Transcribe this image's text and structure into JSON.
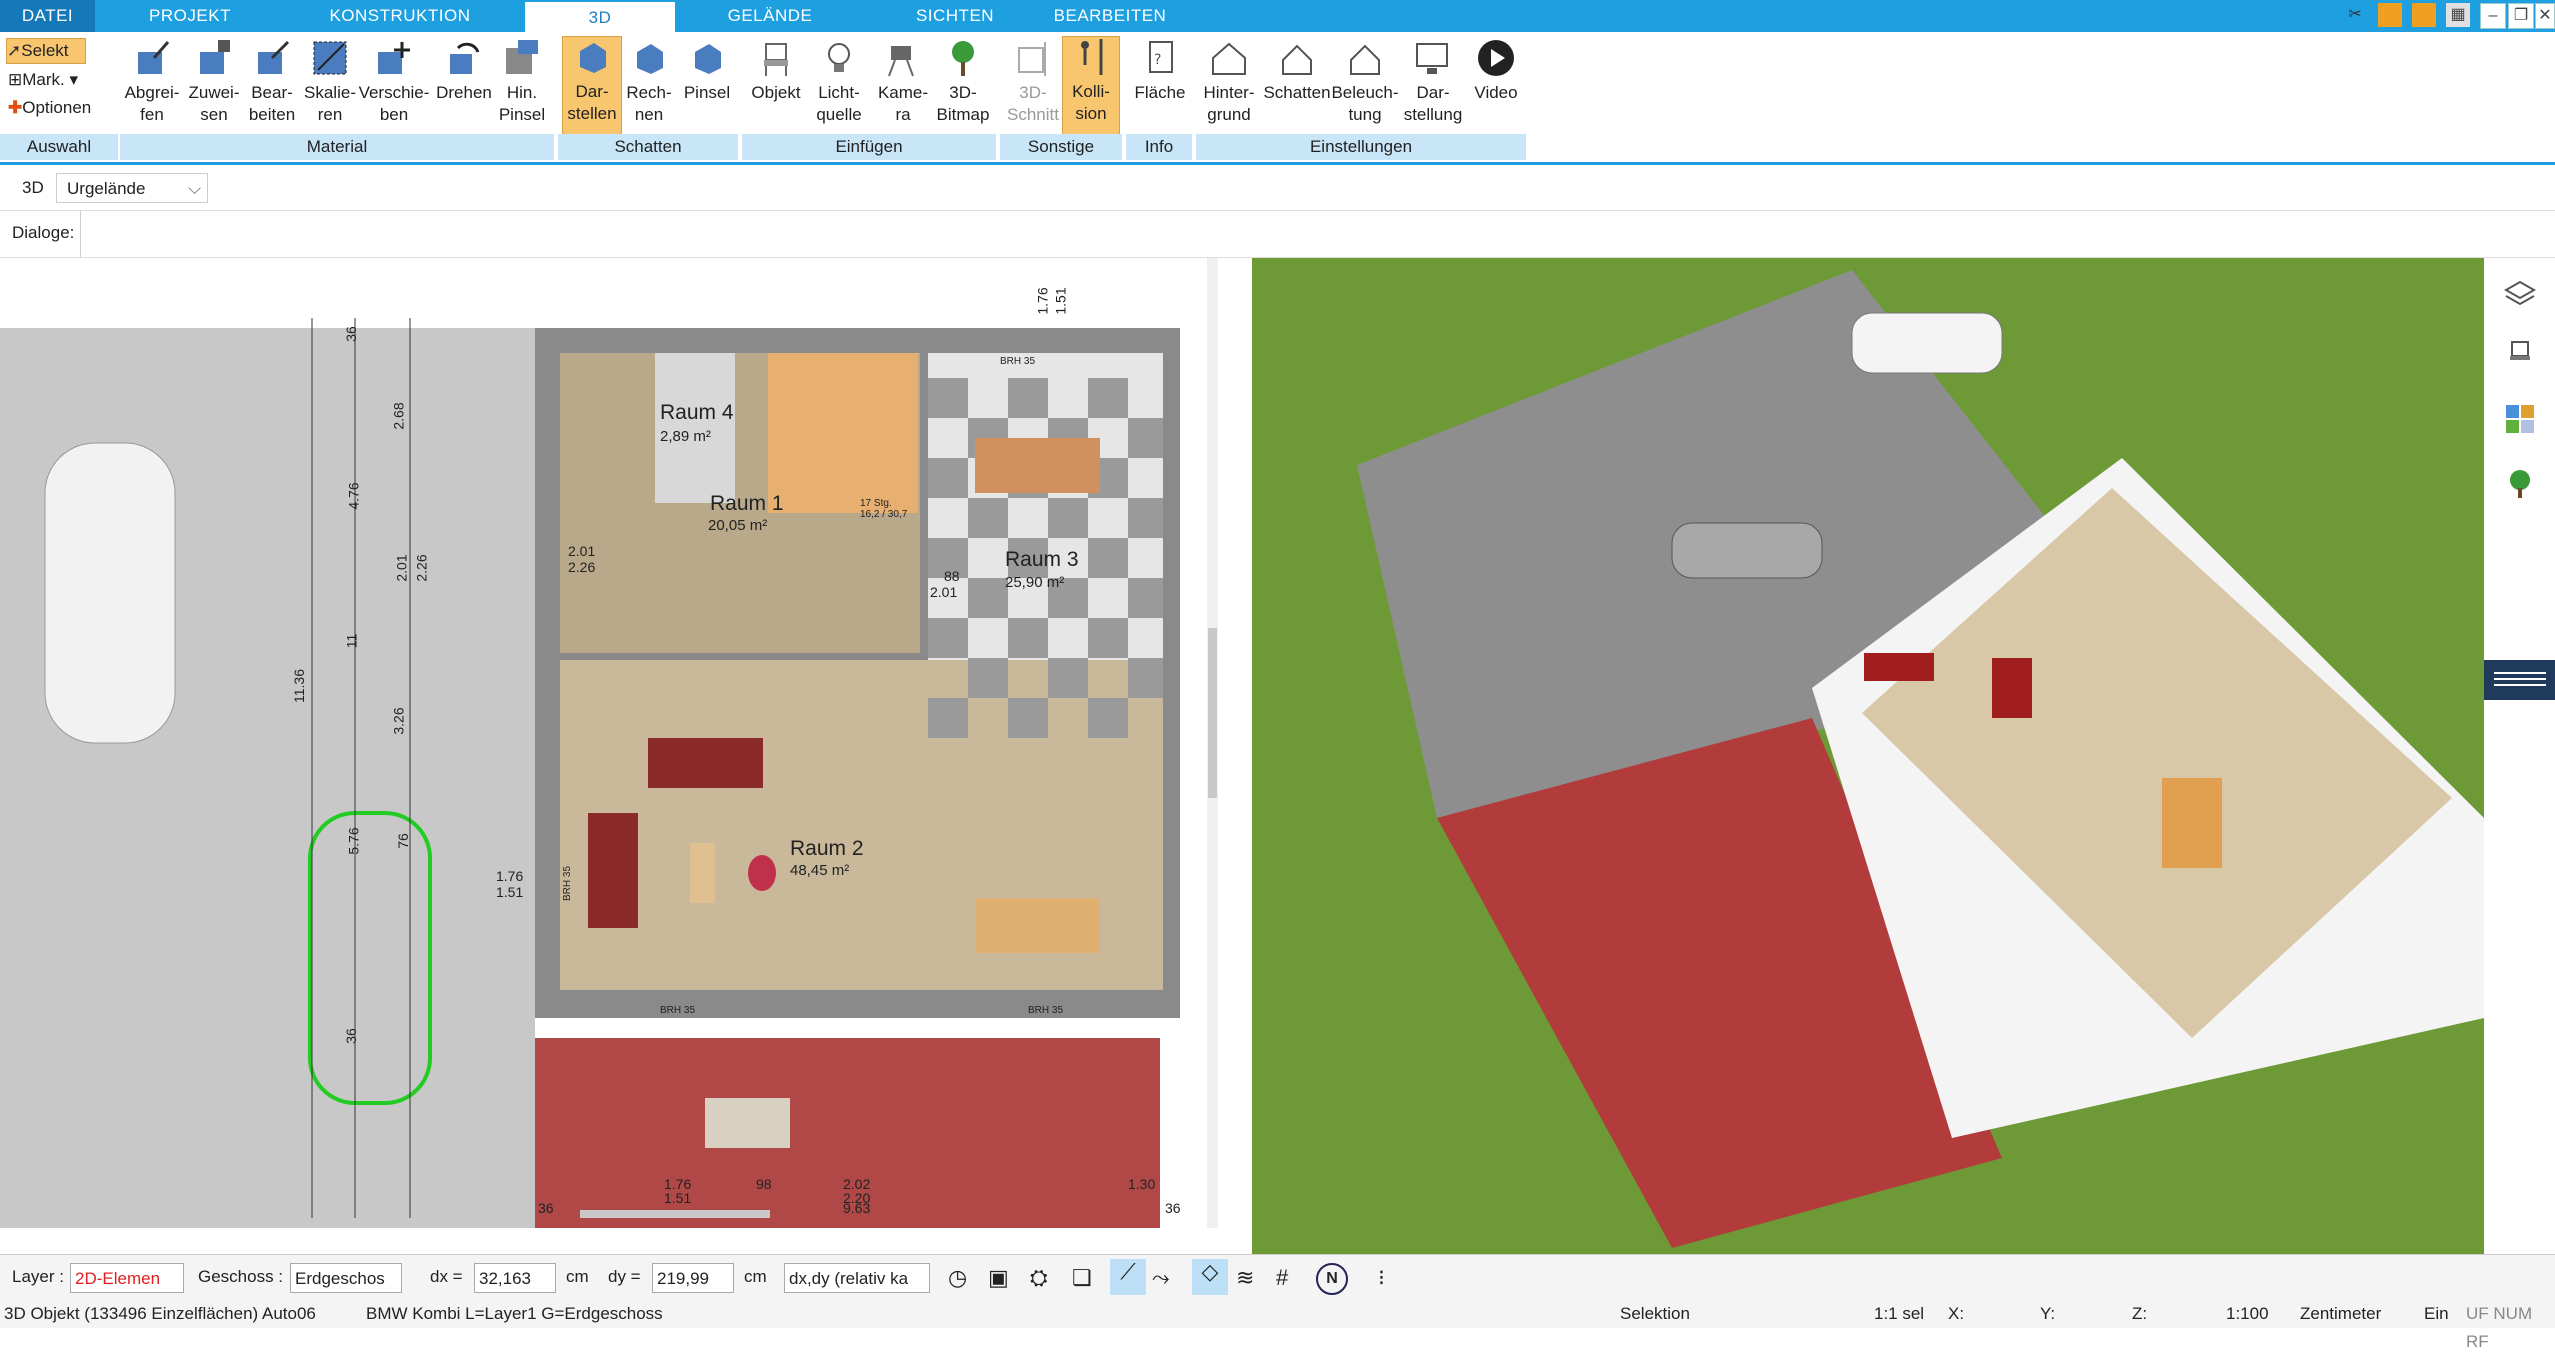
{
  "menu": {
    "tabs": [
      "DATEI",
      "PROJEKT",
      "KONSTRUKTION",
      "3D",
      "GELÄNDE",
      "SICHTEN",
      "BEARBEITEN"
    ]
  },
  "ribbon": {
    "auswahl": {
      "selekt": "Selekt",
      "mark": "Mark.",
      "optionen": "Optionen",
      "group": "Auswahl"
    },
    "material": {
      "items": [
        "Abgrei-\nfen",
        "Zuwei-\nsen",
        "Bear-\nbeiten",
        "Skalie-\nren",
        "Verschie-\nben",
        "Drehen",
        "Hin.\nPinsel"
      ],
      "group": "Material"
    },
    "schatten": {
      "items": [
        "Dar-\nstellen",
        "Rech-\nnen",
        "Pinsel"
      ],
      "group": "Schatten"
    },
    "einfuegen": {
      "items": [
        "Objekt",
        "Licht-\nquelle",
        "Kame-\nra",
        "3D-\nBitmap"
      ],
      "group": "Einfügen"
    },
    "sonstige": {
      "items": [
        "3D-\nSchnitt",
        "Kolli-\nsion"
      ],
      "group": "Sonstige"
    },
    "info": {
      "items": [
        "Fläche"
      ],
      "group": "Info"
    },
    "einstellungen": {
      "items": [
        "Hinter-\ngrund",
        "Schatten",
        "Beleuch-\ntung",
        "Dar-\nstellung",
        "Video"
      ],
      "group": "Einstellungen"
    }
  },
  "subbar": {
    "view_label": "3D",
    "terrain_select": "Urgelände",
    "dialoge_label": "Dialoge:"
  },
  "plan": {
    "rooms": [
      {
        "name": "Raum 4",
        "area": "2,89 m²"
      },
      {
        "name": "Raum 1",
        "area": "20,05 m²"
      },
      {
        "name": "Raum 3",
        "area": "25,90 m²"
      },
      {
        "name": "Raum 2",
        "area": "48,45 m²"
      }
    ],
    "stair_note": "17 Stg.\n16,2 / 30,7",
    "dims": [
      "36",
      "2.68",
      "4.76",
      "2.01",
      "2.26",
      "11.36",
      "11",
      "3.26",
      "5.76",
      "76",
      "36",
      "1.76",
      "1.51",
      "2.01",
      "2.26",
      "88",
      "2.01",
      "1.76",
      "1.51",
      "BRH 35",
      "BRH 35",
      "BRH 35",
      "BRH 35",
      "2.02",
      "2.20",
      "1.76",
      "1.51",
      "98",
      "1.30",
      "9.63",
      "36",
      "36"
    ]
  },
  "bottom": {
    "layer_label": "Layer :",
    "layer_value": "2D-Elemen",
    "geschoss_label": "Geschoss :",
    "geschoss_value": "Erdgeschos",
    "dx_label": "dx =",
    "dx_value": "32,163",
    "cm1": "cm",
    "dy_label": "dy =",
    "dy_value": "219,99",
    "cm2": "cm",
    "mode_value": "dx,dy (relativ ka"
  },
  "status": {
    "object": "3D Objekt (133496 Einzelflächen) Auto06",
    "name": "BMW Kombi L=Layer1 G=Erdgeschoss",
    "mode": "Selektion",
    "sel": "1:1 sel",
    "x": "X:",
    "y": "Y:",
    "z": "Z:",
    "scale": "1:100",
    "unit": "Zentimeter",
    "ein": "Ein",
    "flags": "UF NUM RF"
  }
}
